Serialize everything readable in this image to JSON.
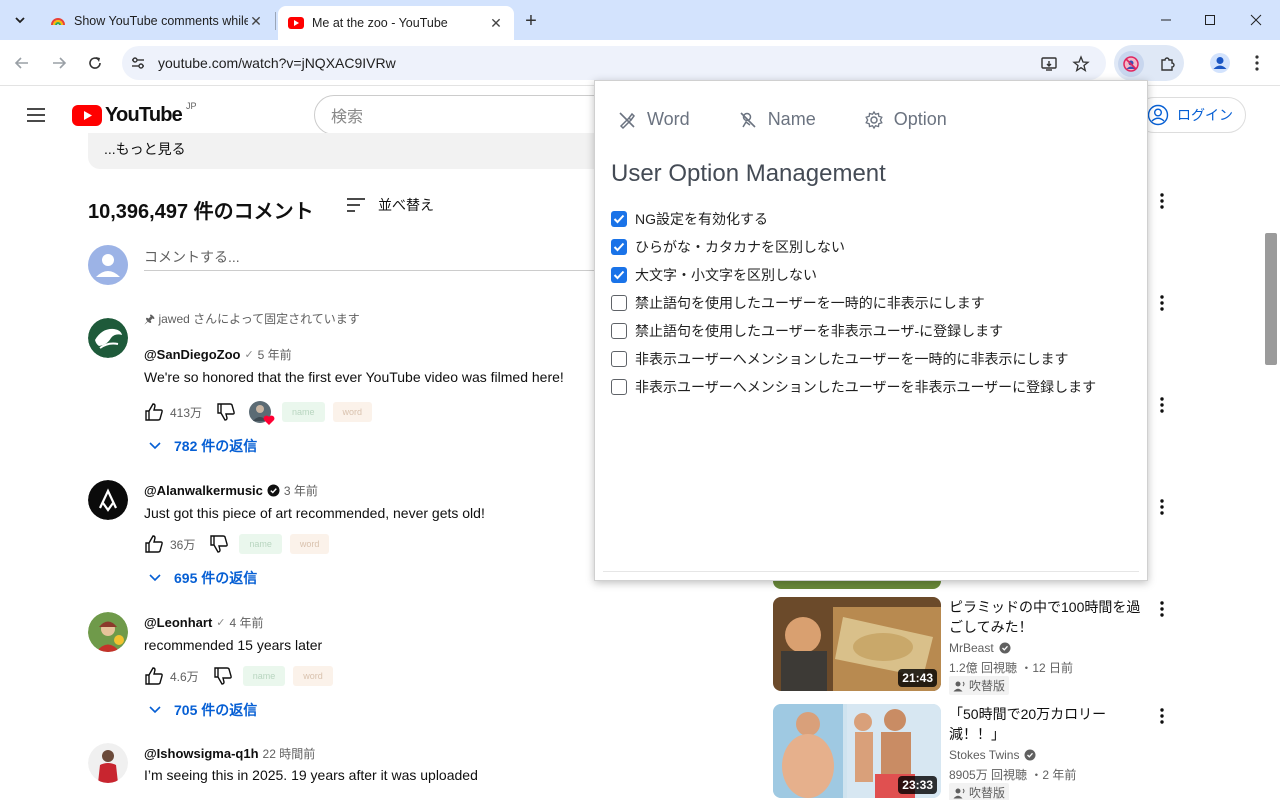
{
  "browser": {
    "tabs": [
      {
        "title": "Show YouTube comments while",
        "active": false
      },
      {
        "title": "Me at the zoo - YouTube",
        "active": true
      }
    ],
    "url": "youtube.com/watch?v=jNQXAC9IVRw"
  },
  "youtube": {
    "logo_text": "YouTube",
    "region": "JP",
    "search_placeholder": "検索",
    "login_label": "ログイン",
    "desc_more": "...もっと見る",
    "comments_count": "10,396,497 件のコメント",
    "sort_label": "並べ替え",
    "add_comment_placeholder": "コメントする...",
    "comments": [
      {
        "pinned": "jawed さんによって固定されています",
        "author": "@SanDiegoZoo",
        "check": "✓",
        "when": "5 年前",
        "text": "We're so honored that the first ever YouTube video was filmed here!",
        "likes": "413万",
        "tag_name": "name",
        "tag_word": "word",
        "replies": "782 件の返信"
      },
      {
        "author": "@Alanwalkermusic",
        "when": "3 年前",
        "text": "Just got this piece of art recommended, never gets old!",
        "likes": "36万",
        "tag_name": "name",
        "tag_word": "word",
        "replies": "695 件の返信"
      },
      {
        "author": "@Leonhart",
        "check": "✓",
        "when": "4 年前",
        "text": "recommended 15 years later",
        "likes": "4.6万",
        "tag_name": "name",
        "tag_word": "word",
        "replies": "705 件の返信"
      },
      {
        "author": "@Ishowsigma-q1h",
        "when": "22 時間前",
        "text": "I’m seeing this in 2025. 19 years after it was uploaded"
      }
    ],
    "videos": [
      {
        "title": "ピラミッドの中で100時間を過ごしてみた！",
        "channel": "MrBeast",
        "stats": "1.2億 回視聴 ・12 日前",
        "badge": "吹替版",
        "duration": "21:43"
      },
      {
        "title": "「50時間で20万カロリー減！！」",
        "channel": "Stokes Twins",
        "stats": "8905万 回視聴 ・2 年前",
        "badge": "吹替版",
        "duration": "23:33"
      }
    ]
  },
  "popup": {
    "tabs": [
      "Word",
      "Name",
      "Option"
    ],
    "heading": "User Option Management",
    "options": [
      {
        "label": "NG設定を有効化する",
        "checked": true
      },
      {
        "label": "ひらがな・カタカナを区別しない",
        "checked": true
      },
      {
        "label": "大文字・小文字を区別しない",
        "checked": true
      },
      {
        "label": "禁止語句を使用したユーザーを一時的に非表示にします",
        "checked": false
      },
      {
        "label": "禁止語句を使用したユーザーを非表示ユーザ-に登録します",
        "checked": false
      },
      {
        "label": "非表示ユーザーへメンションしたユーザーを一時的に非表示にします",
        "checked": false
      },
      {
        "label": "非表示ユーザーへメンションしたユーザーを非表示ユーザーに登録します",
        "checked": false
      }
    ]
  },
  "colors": {
    "tabstrip": "#d3e3fd",
    "youtube_red": "#ff0000",
    "link_blue": "#065fd4",
    "checkbox_blue": "#1a73e8"
  }
}
